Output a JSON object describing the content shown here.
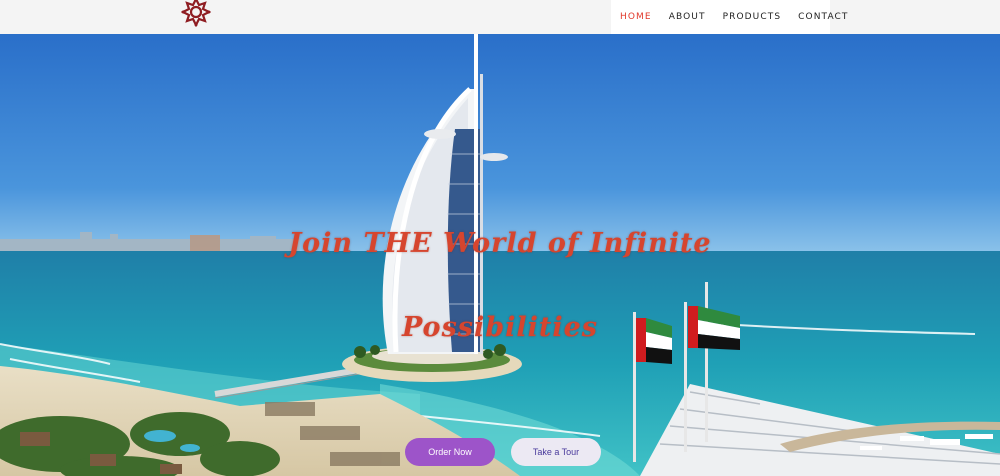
{
  "nav": {
    "items": [
      {
        "label": "HOME",
        "active": true
      },
      {
        "label": "ABOUT",
        "active": false
      },
      {
        "label": "PRODUCTS",
        "active": false
      },
      {
        "label": "CONTACT",
        "active": false
      }
    ],
    "active_color": "#e1392b"
  },
  "hero": {
    "headline_line1": "Join THE World of Infinite",
    "headline_line2": "Possibilities",
    "headline_color": "#d6452e",
    "primary_button": "Order Now",
    "secondary_button": "Take a Tour",
    "primary_color": "#9d54c9"
  },
  "brand": {
    "logo_icon": "ornamental-star-logo",
    "logo_color": "#8f1d22"
  }
}
